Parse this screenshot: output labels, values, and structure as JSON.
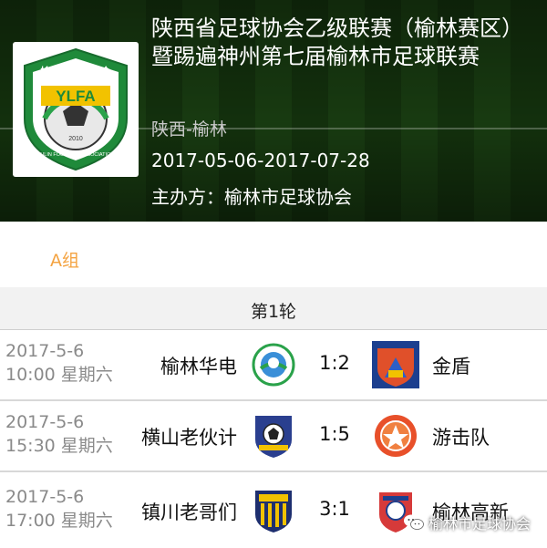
{
  "league": {
    "title": "陕西省足球协会乙级联赛（榆林赛区）暨踢遍神州第七届榆林市足球联赛",
    "region": "陕西-榆林",
    "dates": "2017-05-06-2017-07-28",
    "organizer": "主办方：榆林市足球协会",
    "logo_text_top": "榆林市足球协会",
    "logo_text_mid": "YLFA",
    "logo_text_bottom": "YULIN FOOTBALL ASSOCIATION",
    "logo_year": "2010"
  },
  "group": {
    "label": "A组"
  },
  "round": {
    "label": "第1轮"
  },
  "matches": [
    {
      "date": "2017-5-6",
      "time": "10:00 星期六",
      "home": "榆林华电",
      "score": "1:2",
      "away": "金盾",
      "home_logo": "huadian-logo-icon",
      "away_logo": "jindun-logo-icon"
    },
    {
      "date": "2017-5-6",
      "time": "15:30 星期六",
      "home": "横山老伙计",
      "score": "1:5",
      "away": "游击队",
      "home_logo": "hengshan-logo-icon",
      "away_logo": "youjidui-logo-icon"
    },
    {
      "date": "2017-5-6",
      "time": "17:00 星期六",
      "home": "镇川老哥们",
      "score": "3:1",
      "away": "榆林高新",
      "home_logo": "zhenchuan-logo-icon",
      "away_logo": "gaoxin-logo-icon"
    }
  ],
  "watermark": {
    "text": "榆林市足球协会",
    "icon": "wechat-icon"
  },
  "colors": {
    "accent": "#f4a341",
    "logo_green": "#1f8a3a"
  }
}
